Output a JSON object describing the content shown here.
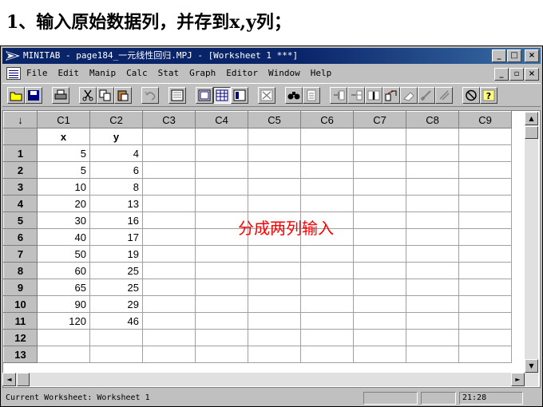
{
  "slide": {
    "title": "1、输入原始数据列，并存到x,y列；"
  },
  "window": {
    "title": "MINITAB - page184_一元线性回归.MPJ - [Worksheet 1 ***]",
    "buttons": {
      "minimize": "_",
      "maximize": "□",
      "close": "×"
    },
    "mdi_buttons": {
      "minimize": "_",
      "restore": "▫",
      "close": "×"
    }
  },
  "menus": [
    "File",
    "Edit",
    "Manip",
    "Calc",
    "Stat",
    "Graph",
    "Editor",
    "Window",
    "Help"
  ],
  "toolbar": {
    "icons": [
      "open-icon",
      "save-icon",
      "print-icon",
      "cut-icon",
      "copy-icon",
      "paste-icon",
      "undo-icon",
      "session-icon",
      "project-manager-icon",
      "data-window-icon",
      "info-icon",
      "close-graphs-icon",
      "find-icon",
      "help-index-icon",
      "insert-cells-icon",
      "insert-rows-icon",
      "insert-columns-icon",
      "move-columns-icon",
      "clear-icon",
      "brush-icon",
      "delete-icon",
      "stop-icon",
      "help-icon"
    ]
  },
  "worksheet": {
    "corner": "↓",
    "columns": [
      "C1",
      "C2",
      "C3",
      "C4",
      "C5",
      "C6",
      "C7",
      "C8",
      "C9"
    ],
    "names": [
      "x",
      "y",
      "",
      "",
      "",
      "",
      "",
      "",
      ""
    ],
    "rows": [
      {
        "n": "1",
        "x": "5",
        "y": "4"
      },
      {
        "n": "2",
        "x": "5",
        "y": "6"
      },
      {
        "n": "3",
        "x": "10",
        "y": "8"
      },
      {
        "n": "4",
        "x": "20",
        "y": "13"
      },
      {
        "n": "5",
        "x": "30",
        "y": "16"
      },
      {
        "n": "6",
        "x": "40",
        "y": "17"
      },
      {
        "n": "7",
        "x": "50",
        "y": "19"
      },
      {
        "n": "8",
        "x": "60",
        "y": "25"
      },
      {
        "n": "9",
        "x": "65",
        "y": "25"
      },
      {
        "n": "10",
        "x": "90",
        "y": "29"
      },
      {
        "n": "11",
        "x": "120",
        "y": "46"
      },
      {
        "n": "12",
        "x": "",
        "y": ""
      },
      {
        "n": "13",
        "x": "",
        "y": ""
      }
    ]
  },
  "annotation": "分成两列输入",
  "status": {
    "text": "Current Worksheet: Worksheet 1",
    "time": "21:28"
  },
  "colors": {
    "titlebar": "#0a246a",
    "annotation": "#ff0000",
    "chrome": "#c0c0c0"
  }
}
